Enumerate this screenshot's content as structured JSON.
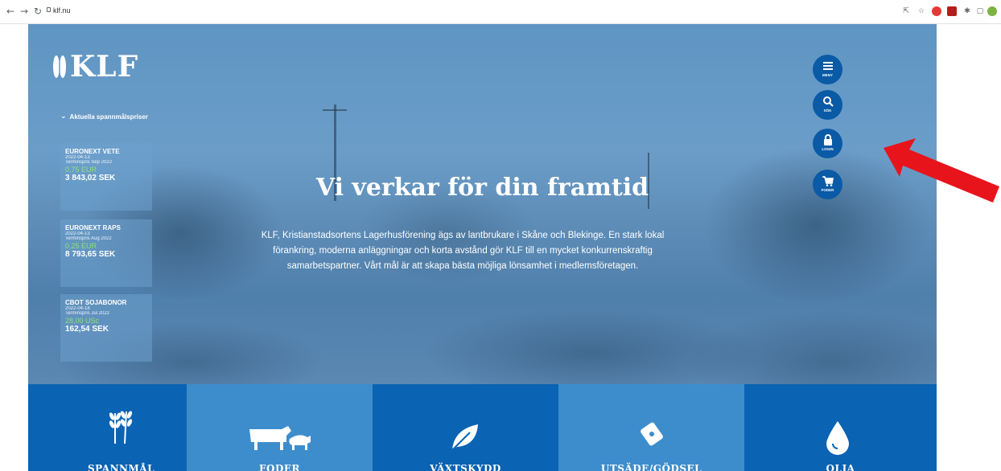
{
  "browser": {
    "url": "klf.nu"
  },
  "site": {
    "logo_text": "KLF",
    "prices_toggle": "Aktuella spannmålspriser"
  },
  "prices": [
    {
      "name": "EURONEXT VETE",
      "date": "2022-04-13",
      "term": "Terminspris Sep 2022",
      "eur": "0,75 EUR",
      "sek": "3 843,02 SEK"
    },
    {
      "name": "EURONEXT RAPS",
      "date": "2022-04-13",
      "term": "Terminspris Aug 2022",
      "eur": "0,25 EUR",
      "sek": "8 793,65 SEK"
    },
    {
      "name": "CBOT SOJABONOR",
      "date": "2022-04-18",
      "term": "Terminspris Jul 2022",
      "eur": "28,00 USc",
      "sek": "162,54 SEK"
    }
  ],
  "hero": {
    "title": "Vi verkar för din framtid",
    "text": "KLF, Kristianstadsortens Lagerhusförening ägs av lantbrukare i Skåne och Blekinge. En stark lokal förankring, moderna anläggningar och korta avstånd gör KLF till en mycket konkurrenskraftig samarbetspartner. Vårt mål är att skapa bästa möjliga lönsamhet i medlemsföretagen."
  },
  "side_menu": [
    {
      "label": "MENY",
      "icon": "menu-icon"
    },
    {
      "label": "SÖK",
      "icon": "search-icon"
    },
    {
      "label": "LOGIN",
      "icon": "lock-icon"
    },
    {
      "label": "FODER",
      "icon": "cart-icon"
    }
  ],
  "tiles": [
    {
      "label": "SPANNMÅL",
      "icon": "wheat-icon",
      "color": "#0a63b3"
    },
    {
      "label": "FODER",
      "icon": "cow-pig-icon",
      "color": "#3d8dcc"
    },
    {
      "label": "VÄXTSKYDD",
      "icon": "leaf-icon",
      "color": "#0a63b3"
    },
    {
      "label": "UTSÄDE/GÖDSEL",
      "icon": "seed-bag-icon",
      "color": "#3d8dcc"
    },
    {
      "label": "OLJA",
      "icon": "droplet-icon",
      "color": "#0a63b3"
    }
  ],
  "annotation_arrow_color": "#e8141c"
}
